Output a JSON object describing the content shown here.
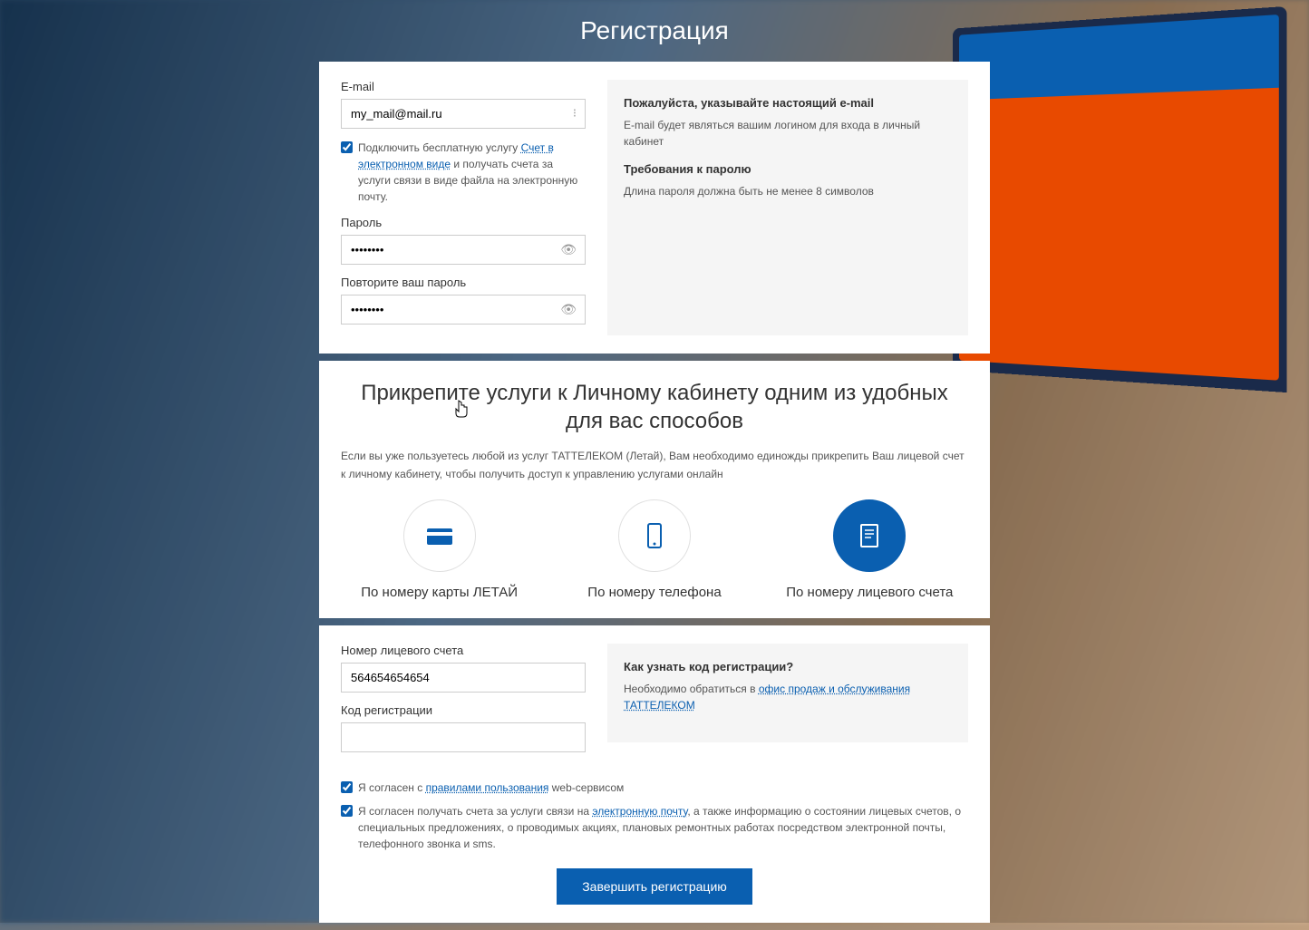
{
  "page": {
    "title": "Регистрация"
  },
  "form": {
    "email_label": "E-mail",
    "email_value": "my_mail@mail.ru",
    "connect_prefix": "Подключить бесплатную услугу ",
    "connect_link": "Счет в электронном виде",
    "connect_suffix": " и получать счета за услуги связи в виде файла на электронную почту.",
    "password_label": "Пароль",
    "password_value": "••••••••",
    "confirm_label": "Повторите ваш пароль",
    "confirm_value": "••••••••"
  },
  "hints": {
    "email_title": "Пожалуйста, указывайте настоящий e-mail",
    "email_text": "E-mail будет являться вашим логином для входа в личный кабинет",
    "pw_title": "Требования к паролю",
    "pw_text": "Длина пароля должна быть не менее 8 символов"
  },
  "attach": {
    "title": "Прикрепите услуги к Личному кабинету одним из удобных для вас способов",
    "subtitle": "Если вы уже пользуетесь любой из услуг ТАТТЕЛЕКОМ (Летай), Вам необходимо единожды прикрепить Ваш лицевой счет к личному кабинету, чтобы получить доступ к управлению услугами онлайн",
    "options": [
      {
        "label": "По номеру карты ЛЕТАЙ"
      },
      {
        "label": "По номеру телефона"
      },
      {
        "label": "По номеру лицевого счета"
      }
    ]
  },
  "account": {
    "number_label": "Номер лицевого счета",
    "number_value": "564654654654",
    "code_label": "Код регистрации",
    "hint_title": "Как узнать код регистрации?",
    "hint_prefix": "Необходимо обратиться в ",
    "hint_link": "офис продаж и обслуживания ТАТТЕЛЕКОМ"
  },
  "agree": {
    "rules_prefix": "Я согласен с ",
    "rules_link": "правилами пользования",
    "rules_suffix": " web-сервисом",
    "marketing_prefix": "Я согласен получать счета за услуги связи на ",
    "marketing_link": "электронную почту",
    "marketing_suffix": ", а также информацию о состоянии лицевых счетов, о специальных предложениях, о проводимых акциях, плановых ремонтных работах посредством электронной почты, телефонного звонка и sms."
  },
  "button": {
    "submit": "Завершить регистрацию"
  }
}
